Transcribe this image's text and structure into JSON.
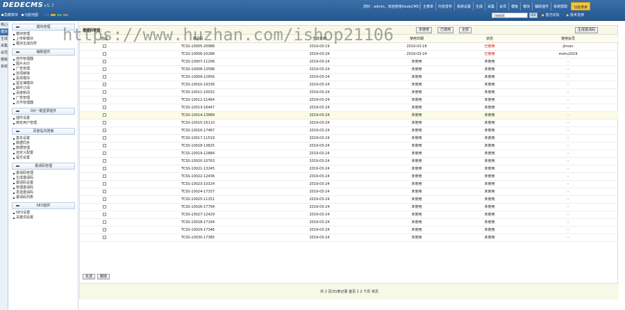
{
  "header": {
    "logo": "DEDECMS",
    "version": "v5.7",
    "quick": [
      "隐藏菜单",
      "功能地图"
    ],
    "swatch_colors": [
      "#3c70ab",
      "#e0b020",
      "#5aa05a",
      "#888888"
    ],
    "welcome": "您好：admin，欢迎使用DedeCMS！",
    "nav": [
      "主菜单",
      "内容发布",
      "系统设置",
      "生成",
      "采集",
      "会员",
      "模板",
      "模块",
      "辅助插件",
      "系统帮助"
    ],
    "nav_hl": "功能搜索",
    "search_placeholder": "功能搜索",
    "search_btn": "搜索",
    "links": [
      "官方论坛",
      "技术支持"
    ]
  },
  "sidetabs": [
    "核心",
    "模块",
    "生成",
    "采集",
    "会员",
    "模板",
    "系统"
  ],
  "sidetab_active": 1,
  "menu": [
    {
      "group": "模块管理",
      "items": [
        "模块管理",
        "上传新模块",
        "模块生成向导"
      ]
    },
    {
      "group": "辅助插件",
      "items": [
        "挂件管理器",
        "图片水印",
        "广告管理",
        "友情链接",
        "投票模块",
        "留言簿模块",
        "邮件订阅",
        "百度新闻",
        "广告管理",
        "文件管理器"
      ]
    },
    {
      "group": "QQ一键登录插件",
      "items": [
        "插件设置",
        "绑定用户管理"
      ]
    },
    {
      "group": "百度站内搜索",
      "items": [
        "基本设置",
        "数据同步",
        "数据管理",
        "自定义配置",
        "提交设置"
      ]
    },
    {
      "group": "邀请码管理",
      "items": [
        "邀请码管理",
        "生成邀请码",
        "邀请码设置",
        "管理邀请码",
        "发送邀请码",
        "邀请码列表"
      ]
    },
    {
      "group": "SEO插件",
      "items": [
        "SEO设置",
        "关键词设置"
      ]
    }
  ],
  "main": {
    "title": "邀请码管理：",
    "buttons": [
      "未使用",
      "已使用",
      "全部"
    ],
    "gen_button": "生成邀请码",
    "columns": [
      "选择",
      "邀请码",
      "生成日期",
      "使用日期",
      "状态",
      "使用会员"
    ],
    "rows": [
      [
        "TCSS-10005-20988",
        "2019-03-19",
        "2019-03-18",
        "已使用",
        "jinnan"
      ],
      [
        "TCSS-10006-10288",
        "2019-03-24",
        "2019-03-24",
        "已使用",
        "mohu2019"
      ],
      [
        "TCSS-10007-11206",
        "2019-03-24",
        "未使用",
        "未使用",
        "-"
      ],
      [
        "TCSS-10008-13588",
        "2019-03-24",
        "未使用",
        "未使用",
        "-"
      ],
      [
        "TCSS-10009-12656",
        "2019-03-24",
        "未使用",
        "未使用",
        "-"
      ],
      [
        "TCSS-10010-19336",
        "2019-03-24",
        "未使用",
        "未使用",
        "-"
      ],
      [
        "TCSS-10011-10032",
        "2019-03-24",
        "未使用",
        "未使用",
        "-"
      ],
      [
        "TCSS-10012-11464",
        "2019-03-24",
        "未使用",
        "未使用",
        "-"
      ],
      [
        "TCSS-10013-16447",
        "2019-03-24",
        "未使用",
        "未使用",
        "-"
      ],
      [
        "TCSS-10014-13889",
        "2019-03-24",
        "未使用",
        "未使用",
        "-"
      ],
      [
        "TCSS-10015-16110",
        "2019-03-24",
        "未使用",
        "未使用",
        "-"
      ],
      [
        "TCSS-10016-17487",
        "2019-03-24",
        "未使用",
        "未使用",
        "-"
      ],
      [
        "TCSS-10017-11519",
        "2019-03-24",
        "未使用",
        "未使用",
        "-"
      ],
      [
        "TCSS-10018-13825",
        "2019-03-24",
        "未使用",
        "未使用",
        "-"
      ],
      [
        "TCSS-10019-12884",
        "2019-03-24",
        "未使用",
        "未使用",
        "-"
      ],
      [
        "TCSS-10020-10763",
        "2019-03-24",
        "未使用",
        "未使用",
        "-"
      ],
      [
        "TCSS-10021-13245",
        "2019-03-24",
        "未使用",
        "未使用",
        "-"
      ],
      [
        "TCSS-10022-12436",
        "2019-03-24",
        "未使用",
        "未使用",
        "-"
      ],
      [
        "TCSS-10023-10324",
        "2019-03-24",
        "未使用",
        "未使用",
        "-"
      ],
      [
        "TCSS-10024-17337",
        "2019-03-24",
        "未使用",
        "未使用",
        "-"
      ],
      [
        "TCSS-10025-11251",
        "2019-03-24",
        "未使用",
        "未使用",
        "-"
      ],
      [
        "TCSS-10026-17794",
        "2019-03-24",
        "未使用",
        "未使用",
        "-"
      ],
      [
        "TCSS-10027-12429",
        "2019-03-24",
        "未使用",
        "未使用",
        "-"
      ],
      [
        "TCSS-10028-17194",
        "2019-03-24",
        "未使用",
        "未使用",
        "-"
      ],
      [
        "TCSS-10029-17346",
        "2019-03-24",
        "未使用",
        "未使用",
        "-"
      ],
      [
        "TCSS-10030-17385",
        "2019-03-24",
        "未使用",
        "未使用",
        "-"
      ]
    ],
    "hover_row": 9,
    "bottom_buttons": [
      "反选",
      "删除"
    ],
    "pager": "共 2 页/31条记录 首页 1 2 下页 末页"
  },
  "watermark": "https://www.huzhan.com/ishop21106"
}
